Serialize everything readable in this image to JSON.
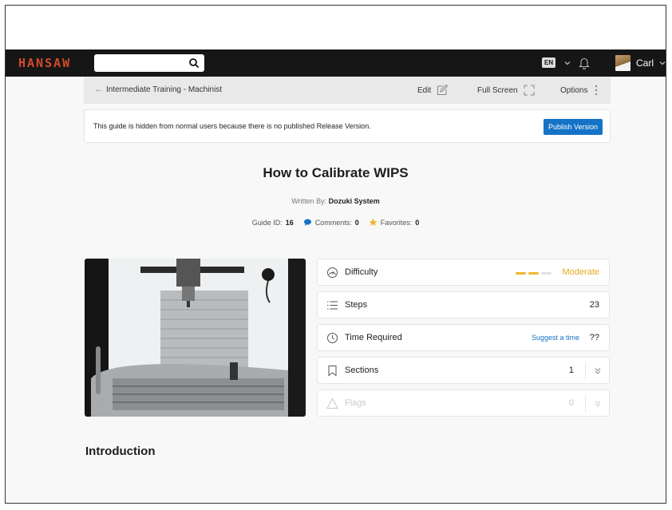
{
  "brand": {
    "logo": "HANSAW",
    "accent": "#d44a2a"
  },
  "topbar": {
    "search": {
      "placeholder": "",
      "value": ""
    },
    "language": "EN",
    "user_name": "Carl"
  },
  "breadcrumb": {
    "back_icon": "arrow-left-icon",
    "label": "Intermediate Training - Machinist",
    "edit_label": "Edit",
    "fullscreen_label": "Full Screen",
    "options_label": "Options"
  },
  "notice": {
    "text": "This guide is hidden from normal users because there is no published Release Version.",
    "button_label": "Publish Version",
    "button_color": "#1573c7"
  },
  "guide": {
    "title": "How to Calibrate WIPS",
    "written_by_label": "Written By:",
    "author": "Dozuki System",
    "id_label": "Guide ID:",
    "id": "16",
    "comments_label": "Comments:",
    "comments": "0",
    "favorites_label": "Favorites:",
    "favorites": "0"
  },
  "details": {
    "difficulty_label": "Difficulty",
    "difficulty_value": "Moderate",
    "difficulty_level": 2,
    "difficulty_max": 3,
    "steps_label": "Steps",
    "steps_value": "23",
    "time_label": "Time Required",
    "time_suggest": "Suggest a time",
    "time_value": "??",
    "sections_label": "Sections",
    "sections_value": "1",
    "flags_label": "Flags",
    "flags_value": "0"
  },
  "introduction_heading": "Introduction"
}
